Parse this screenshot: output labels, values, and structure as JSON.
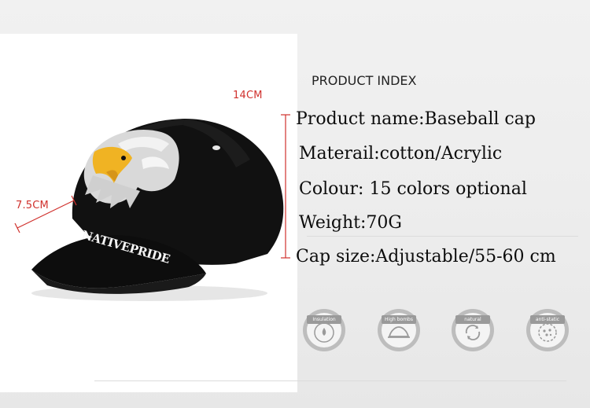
{
  "dimensions": {
    "height": "14CM",
    "brim": "7.5CM"
  },
  "product_index": {
    "title": "PRODUCT INDEX",
    "specs": [
      "Product name:Baseball cap",
      "Materail:cotton/Acrylic",
      "Colour: 15 colors optional",
      "Weight:70G",
      "Cap size:Adjustable/55-60 cm"
    ]
  },
  "cap": {
    "brim_embroidery": "NATIVEPRIDE",
    "color": "#0d0d0d"
  },
  "features": [
    {
      "label": "Insulation",
      "icon": "insulation-icon"
    },
    {
      "label": "High bombs",
      "icon": "high-bombs-icon"
    },
    {
      "label": "natural",
      "icon": "natural-icon"
    },
    {
      "label": "anti-static",
      "icon": "anti-static-icon"
    }
  ],
  "colors": {
    "dimension_red": "#d0312d",
    "badge_gray": "#9a9a9a"
  }
}
